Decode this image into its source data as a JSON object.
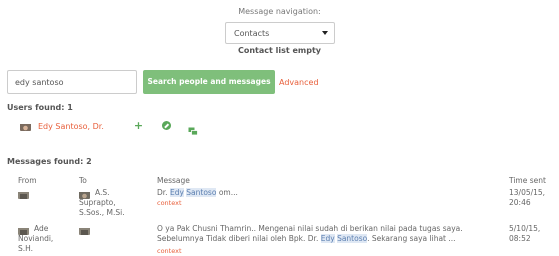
{
  "navigation": {
    "label": "Message navigation:",
    "selected": "Contacts",
    "empty_text": "Contact list empty"
  },
  "search": {
    "value": "edy santoso",
    "button_label": "Search people and messages",
    "advanced_label": "Advanced"
  },
  "users": {
    "heading": "Users found: 1",
    "items": [
      {
        "name": "Edy Santoso, Dr."
      }
    ]
  },
  "messages": {
    "heading": "Messages found: 2",
    "columns": {
      "from": "From",
      "to": "To",
      "message": "Message",
      "time": "Time sent"
    },
    "rows": [
      {
        "from": "",
        "to": [
          "A.S.",
          "Suprapto,",
          "S.Sos., M.Si."
        ],
        "message_before": "Dr. ",
        "message_highlight_1": "Edy",
        "message_space": " ",
        "message_highlight_2": "Santoso",
        "message_after": " om...",
        "context": "context",
        "time": [
          "13/05/15,",
          "20:46"
        ]
      },
      {
        "from": [
          "Ade",
          "Noviandi,",
          "S.H."
        ],
        "to": "",
        "message_line1": "O ya Pak Chusni Thamrin.. Mengenai nilai sudah di berikan nilai pada tugas saya.",
        "message_line2_before": "Sebelumnya Tidak diberi nilai oleh Bpk. Dr. ",
        "message_highlight_1": "Edy",
        "message_space": " ",
        "message_highlight_2": "Santoso",
        "message_after": ". Sekarang saya lihat ...",
        "context": "context",
        "time": [
          "5/10/15,",
          "08:52"
        ]
      }
    ]
  },
  "colors": {
    "accent": "#e8603c",
    "button": "#7fbf7b",
    "icon_green": "#5aa85a",
    "highlight": "#dfe8f4"
  },
  "icons": {
    "add_contact": "plus-icon",
    "block": "block-icon",
    "message": "message-icon",
    "avatar": "user-avatar-photo"
  }
}
